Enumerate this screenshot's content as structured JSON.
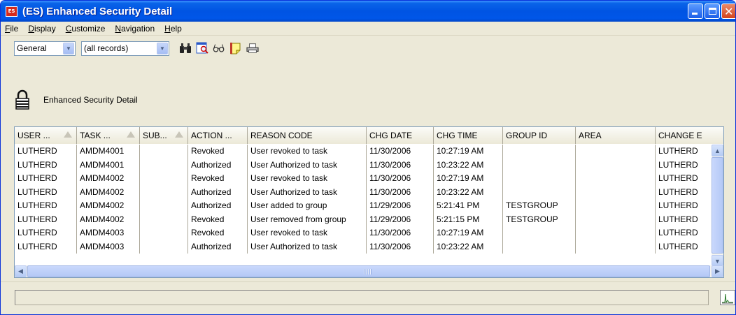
{
  "window": {
    "title": "(ES) Enhanced Security Detail",
    "app_icon_text": "ES"
  },
  "menu": [
    {
      "pre": "",
      "ul": "F",
      "post": "ile"
    },
    {
      "pre": "",
      "ul": "D",
      "post": "isplay"
    },
    {
      "pre": "",
      "ul": "C",
      "post": "ustomize"
    },
    {
      "pre": "",
      "ul": "N",
      "post": "avigation"
    },
    {
      "pre": "",
      "ul": "H",
      "post": "elp"
    }
  ],
  "toolbar": {
    "view_select": "General",
    "filter_select": "(all records)",
    "icons": [
      "binoculars-icon",
      "find-record-icon",
      "glasses-icon",
      "note-icon",
      "print-icon"
    ]
  },
  "header": {
    "title": "Enhanced Security Detail",
    "icon": "lock-icon"
  },
  "grid": {
    "columns": [
      {
        "label": "USER ...",
        "sort": true
      },
      {
        "label": "TASK ...",
        "sort": true
      },
      {
        "label": "SUB...",
        "sort": true
      },
      {
        "label": "ACTION ...",
        "sort": false
      },
      {
        "label": "REASON CODE",
        "sort": false
      },
      {
        "label": "CHG DATE",
        "sort": false
      },
      {
        "label": "CHG TIME",
        "sort": false
      },
      {
        "label": "GROUP ID",
        "sort": false
      },
      {
        "label": "AREA",
        "sort": false
      },
      {
        "label": "CHANGE E",
        "sort": false
      }
    ],
    "rows": [
      [
        "LUTHERD",
        "AMDM4001",
        "",
        "Revoked",
        "User revoked to task",
        "11/30/2006",
        "10:27:19 AM",
        "",
        "",
        "LUTHERD"
      ],
      [
        "LUTHERD",
        "AMDM4001",
        "",
        "Authorized",
        "User Authorized to task",
        "11/30/2006",
        "10:23:22 AM",
        "",
        "",
        "LUTHERD"
      ],
      [
        "LUTHERD",
        "AMDM4002",
        "",
        "Revoked",
        "User revoked to task",
        "11/30/2006",
        "10:27:19 AM",
        "",
        "",
        "LUTHERD"
      ],
      [
        "LUTHERD",
        "AMDM4002",
        "",
        "Authorized",
        "User Authorized to task",
        "11/30/2006",
        "10:23:22 AM",
        "",
        "",
        "LUTHERD"
      ],
      [
        "LUTHERD",
        "AMDM4002",
        "",
        "Authorized",
        "User added to group",
        "11/29/2006",
        "5:21:41 PM",
        "TESTGROUP",
        "",
        "LUTHERD"
      ],
      [
        "LUTHERD",
        "AMDM4002",
        "",
        "Revoked",
        "User removed from group",
        "11/29/2006",
        "5:21:15 PM",
        "TESTGROUP",
        "",
        "LUTHERD"
      ],
      [
        "LUTHERD",
        "AMDM4003",
        "",
        "Revoked",
        "User revoked to task",
        "11/30/2006",
        "10:27:19 AM",
        "",
        "",
        "LUTHERD"
      ],
      [
        "LUTHERD",
        "AMDM4003",
        "",
        "Authorized",
        "User Authorized to task",
        "11/30/2006",
        "10:23:22 AM",
        "",
        "",
        "LUTHERD"
      ]
    ]
  },
  "statusbar": {
    "text": ""
  }
}
